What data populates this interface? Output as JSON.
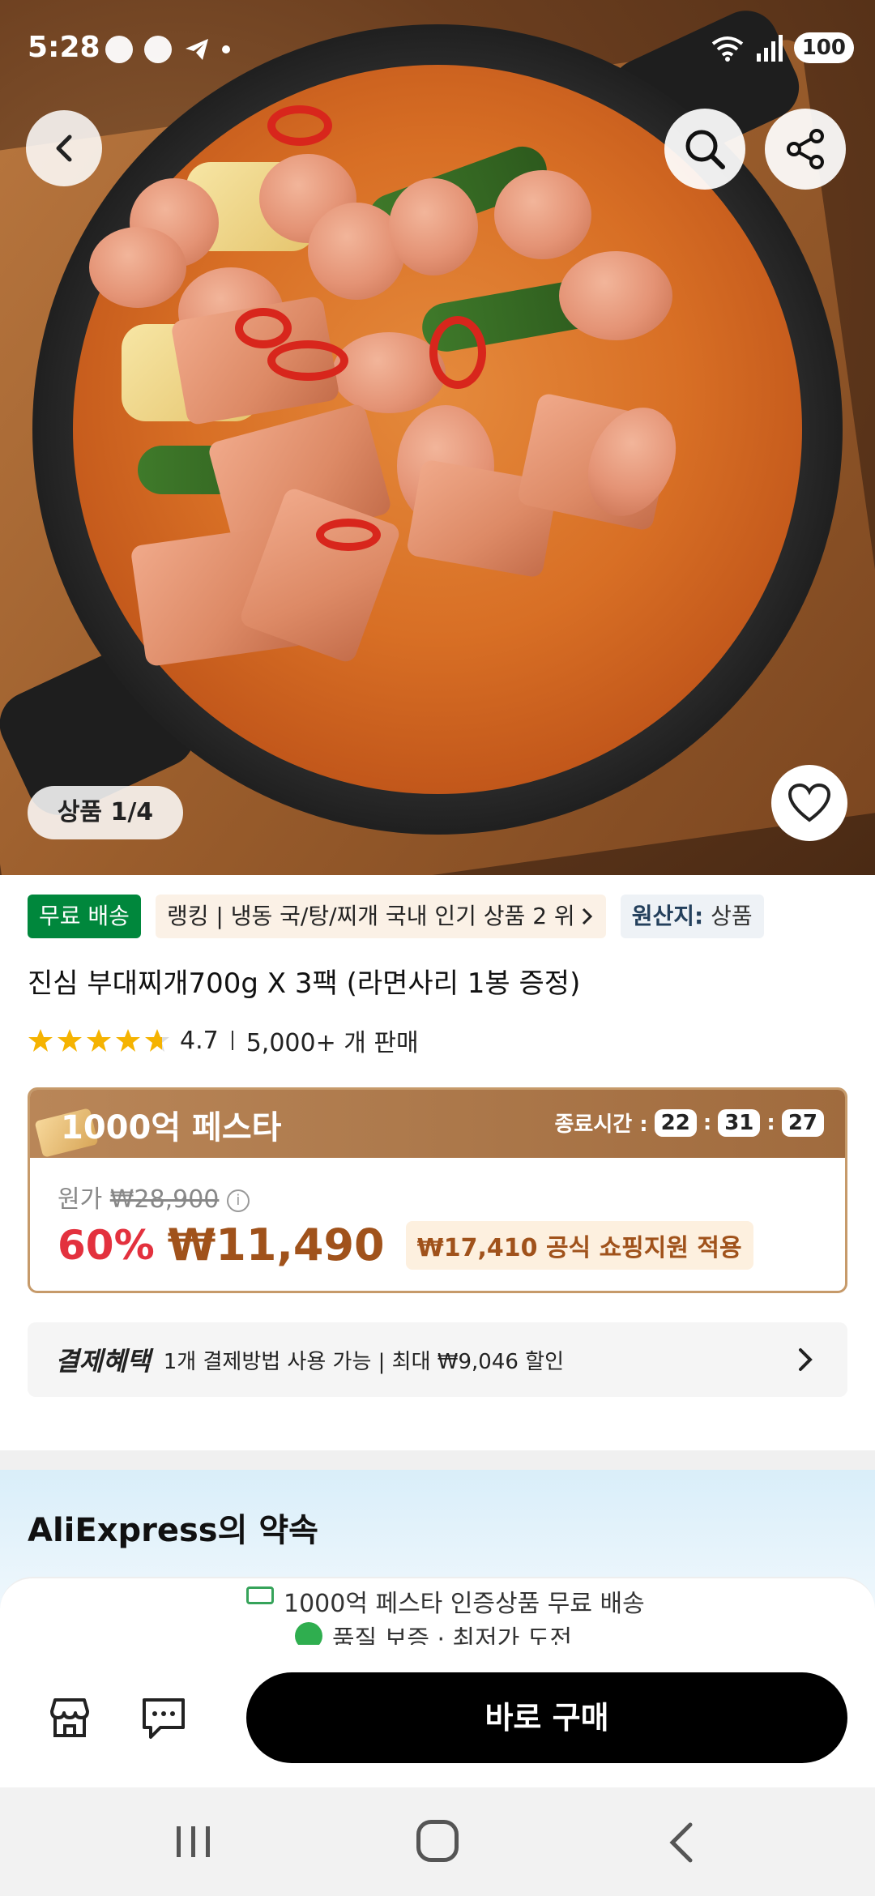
{
  "status_bar": {
    "time": "5:28",
    "battery": "100",
    "icons": [
      "threads-icon",
      "chrome-icon",
      "telegram-icon",
      "notification-dot",
      "wifi-icon",
      "signal-icon",
      "battery-icon"
    ]
  },
  "product_image": {
    "counter": "상품 1/4",
    "buttons": [
      "back-icon",
      "search-icon",
      "share-icon",
      "heart-icon"
    ]
  },
  "tags": {
    "free_shipping": "무료 배송",
    "ranking": "랭킹 | 냉동 국/탕/찌개 국내 인기 상품 2 위",
    "origin_label": "원산지:",
    "origin_value": "상품"
  },
  "product": {
    "title": "진심 부대찌개700g X 3팩 (라면사리 1봉 증정)",
    "rating": "4.7",
    "stars": 4.7,
    "sold": "5,000+ 개 판매"
  },
  "festa": {
    "title": "1000억 페스타",
    "end_label": "종료시간 :",
    "timer": [
      "22",
      "31",
      "27"
    ],
    "original_label": "원가",
    "original_price": "₩28,900",
    "discount": "60%",
    "price": "₩11,490",
    "support": "₩17,410 공식 쇼핑지원 적용"
  },
  "payment": {
    "title": "결제혜택",
    "text": "1개 결제방법 사용 가능 | 최대 ₩9,046 할인"
  },
  "promise": {
    "title": "AliExpress의 약속",
    "line1": "1000억 페스타 인증상품 무료 배송",
    "line2": "품질 보증 · 최저가 도전"
  },
  "action_bar": {
    "buy_label": "바로 구매"
  },
  "colors": {
    "free_shipping": "#00873c",
    "discount": "#e3313e",
    "price": "#a0521b",
    "festa_header": "#a06b3e",
    "buy_button": "#000000"
  }
}
